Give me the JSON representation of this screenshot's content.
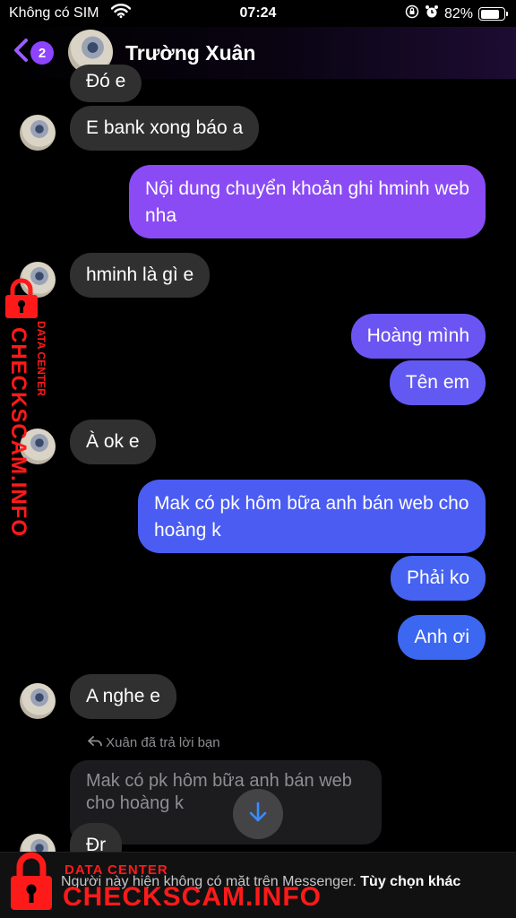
{
  "status_bar": {
    "carrier": "Không có SIM",
    "time": "07:24",
    "battery": "82%",
    "battery_level": 0.82
  },
  "header": {
    "unread_count": "2",
    "contact_name": "Trường Xuân"
  },
  "messages": [
    {
      "side": "in",
      "text": "Đó e"
    },
    {
      "side": "in",
      "text": "E bank xong báo a"
    },
    {
      "side": "out",
      "text": "Nội dung chuyển khoản ghi hminh web nha"
    },
    {
      "side": "in",
      "text": "hminh là gì e"
    },
    {
      "side": "out",
      "text": "Hoàng mình"
    },
    {
      "side": "out",
      "text": "Tên em"
    },
    {
      "side": "in",
      "text": "À ok e"
    },
    {
      "side": "out",
      "text": "Mak có pk hôm bữa anh bán web cho hoàng k"
    },
    {
      "side": "out",
      "text": "Phải ko"
    },
    {
      "side": "out",
      "text": "Anh ơi"
    },
    {
      "side": "in",
      "text": "A nghe e"
    },
    {
      "side": "in",
      "text": "Đr"
    }
  ],
  "reply": {
    "note": "Xuân đã trả lời bạn",
    "quoted_text": "Mak có pk hôm bữa anh bán web cho hoàng k"
  },
  "notice": {
    "text": "Người này hiện không có mặt trên Messenger.",
    "link": "Tùy chọn khác"
  },
  "watermark": {
    "brand": "CHECKSCAM.INFO",
    "tagline": "DATA CENTER",
    "color": "#ff1a1a"
  },
  "colors": {
    "accent": "#8e44ff",
    "incoming_bubble": "#303030"
  }
}
